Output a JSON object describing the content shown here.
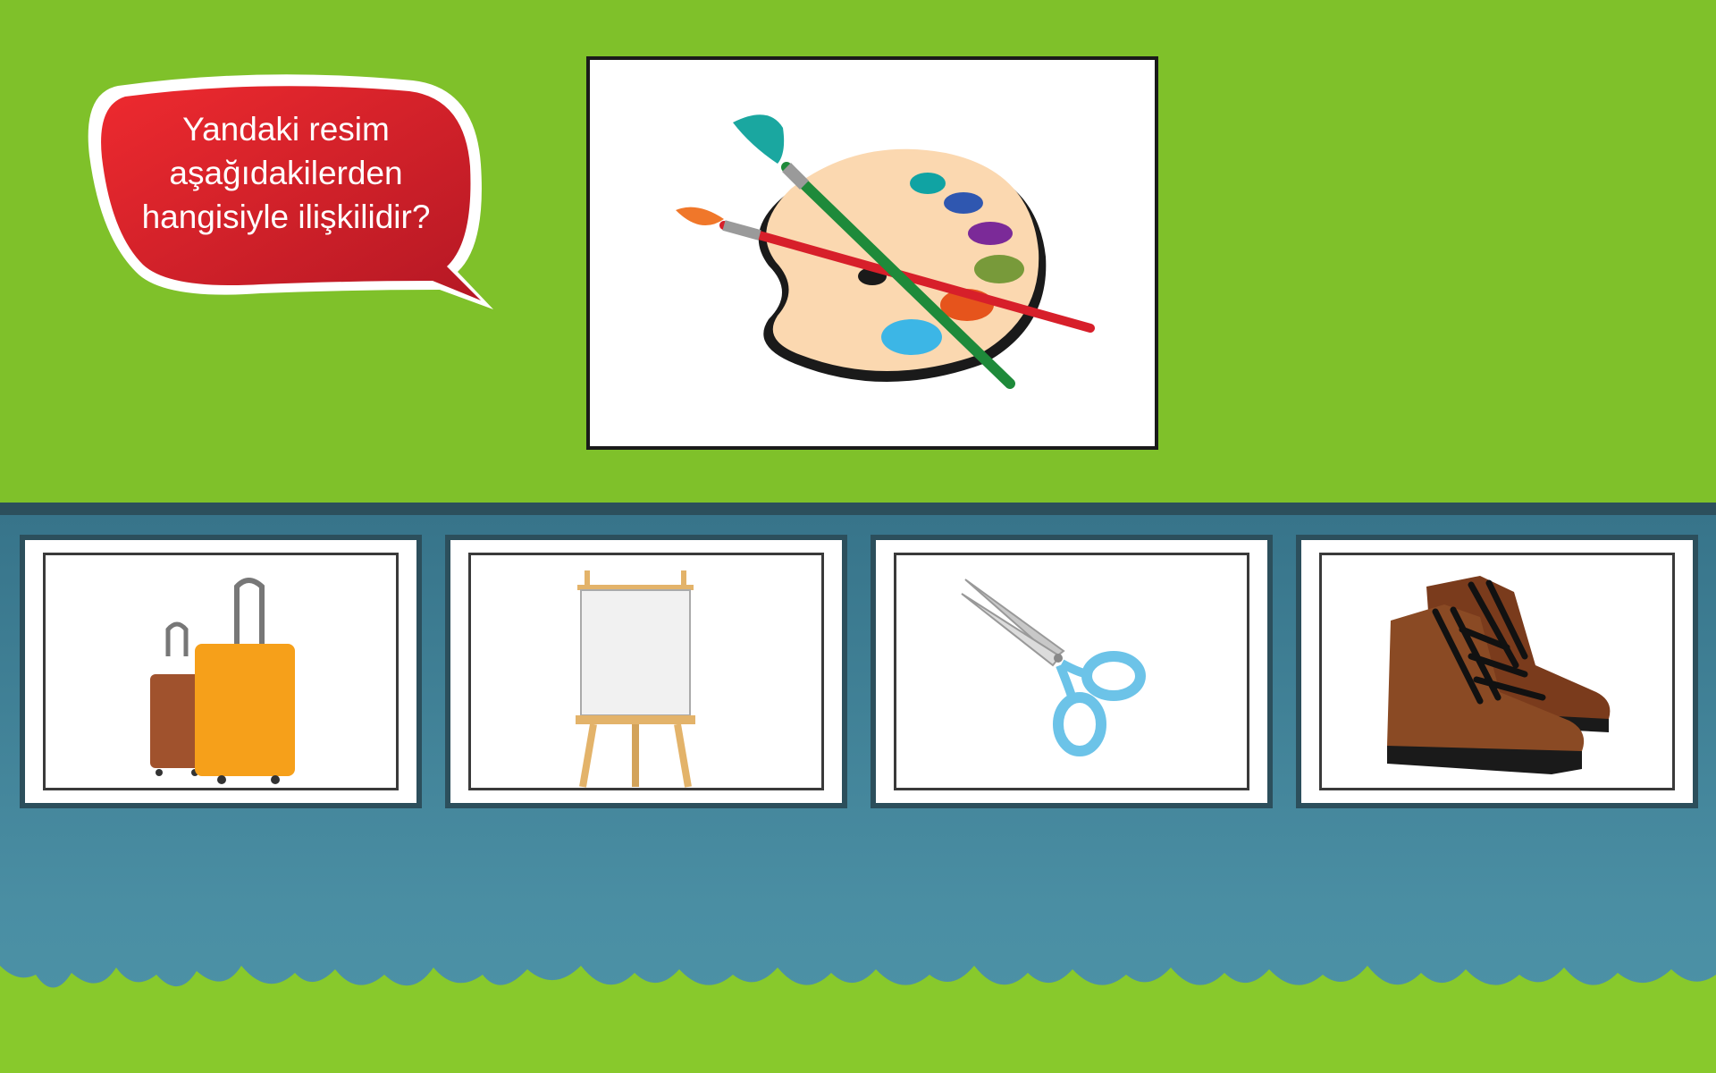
{
  "question": {
    "text": "Yandaki resim\naşağıdakilerden\nhangisiyle ilişkilidir?"
  },
  "main_image": {
    "icon": "palette-with-brushes-icon"
  },
  "choices": [
    {
      "icon": "suitcases-icon"
    },
    {
      "icon": "easel-icon"
    },
    {
      "icon": "scissors-icon"
    },
    {
      "icon": "hiking-boots-icon"
    }
  ],
  "colors": {
    "top_background": "#7fc12a",
    "bottom_background": "#3f8499",
    "divider": "#2c4f5c",
    "bubble": "#d41e2a"
  }
}
